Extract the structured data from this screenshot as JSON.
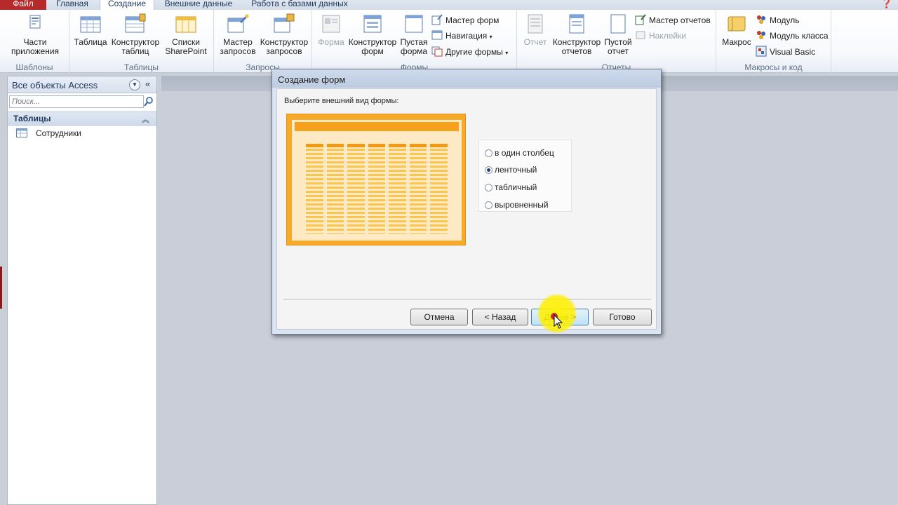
{
  "tabs": {
    "file": "Файл",
    "home": "Главная",
    "create": "Создание",
    "external": "Внешние данные",
    "database": "Работа с базами данных"
  },
  "ribbon": {
    "templates": {
      "app_parts": "Части приложения",
      "group_label": "Шаблоны"
    },
    "tables": {
      "table": "Таблица",
      "table_design": "Конструктор таблиц",
      "sharepoint_lists": "Списки SharePoint",
      "group_label": "Таблицы"
    },
    "queries": {
      "query_wizard": "Мастер запросов",
      "query_design": "Конструктор запросов",
      "group_label": "Запросы"
    },
    "forms": {
      "form": "Форма",
      "form_design": "Конструктор форм",
      "blank_form": "Пустая форма",
      "form_wizard": "Мастер форм",
      "navigation": "Навигация",
      "more_forms": "Другие формы",
      "group_label": "Формы"
    },
    "reports": {
      "report": "Отчет",
      "report_design": "Конструктор отчетов",
      "blank_report": "Пустой отчет",
      "report_wizard": "Мастер отчетов",
      "labels": "Наклейки",
      "group_label": "Отчеты"
    },
    "macros": {
      "macro": "Макрос",
      "module": "Модуль",
      "class_module": "Модуль класса",
      "visual_basic": "Visual Basic",
      "group_label": "Макросы и код"
    }
  },
  "nav": {
    "title": "Все объекты Access",
    "search_placeholder": "Поиск...",
    "group": "Таблицы",
    "items": [
      {
        "label": "Сотрудники"
      }
    ]
  },
  "dialog": {
    "title": "Создание форм",
    "prompt": "Выберите внешний вид формы:",
    "options": [
      {
        "label": "в один столбец",
        "checked": false
      },
      {
        "label": "ленточный",
        "checked": true
      },
      {
        "label": "табличный",
        "checked": false
      },
      {
        "label": "выровненный",
        "checked": false
      }
    ],
    "buttons": {
      "cancel": "Отмена",
      "back": "< Назад",
      "next": "Далее >",
      "finish": "Готово"
    }
  },
  "colors": {
    "file_tab": "#b52a2a",
    "preview_orange": "#f7a928",
    "highlight": "#fff000"
  }
}
